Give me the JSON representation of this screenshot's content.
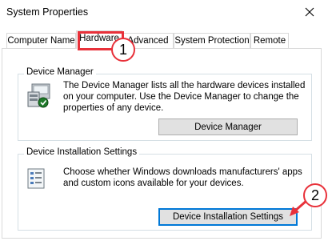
{
  "window": {
    "title": "System Properties"
  },
  "tabs": [
    "Computer Name",
    "Hardware",
    "Advanced",
    "System Protection",
    "Remote"
  ],
  "device_manager": {
    "label": "Device Manager",
    "description": "The Device Manager lists all the hardware devices installed on your computer. Use the Device Manager to change the properties of any device.",
    "button": "Device Manager"
  },
  "device_installation": {
    "label": "Device Installation Settings",
    "description": "Choose whether Windows downloads manufacturers' apps and custom icons available for your devices.",
    "button": "Device Installation Settings"
  },
  "callouts": [
    "1",
    "2"
  ],
  "colors": {
    "highlight_red": "#e8313a",
    "focus_blue": "#0078d7"
  },
  "icons": [
    "close-icon",
    "device-manager-icon",
    "device-settings-icon"
  ]
}
